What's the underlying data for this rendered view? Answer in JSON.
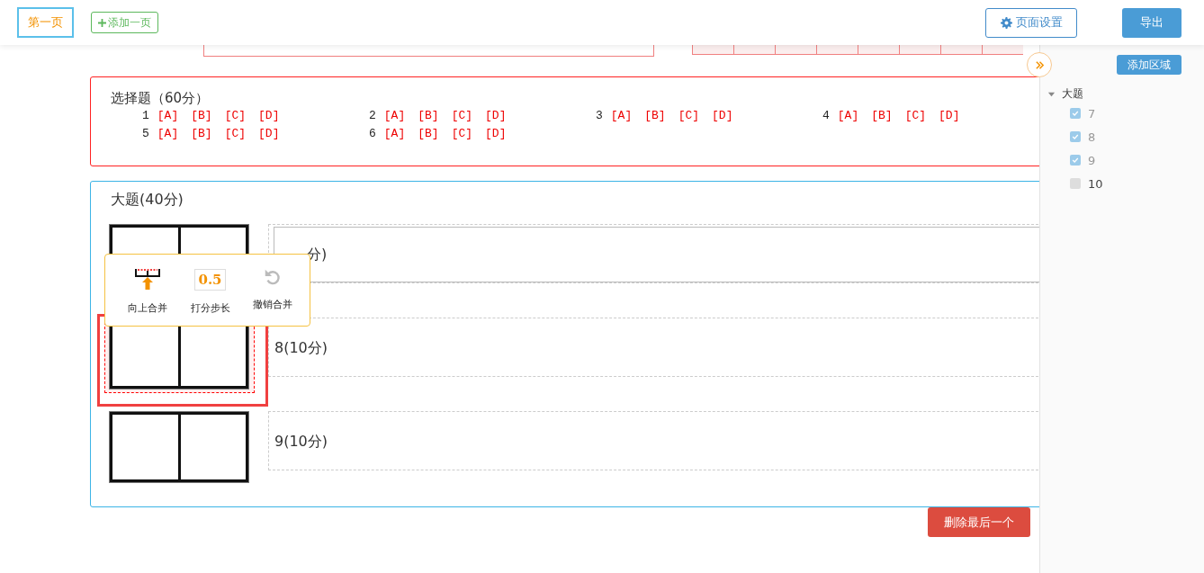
{
  "header": {
    "pages": [
      {
        "label": "第一页",
        "selected": true
      }
    ],
    "add_page": "添加一页",
    "page_settings": "页面设置",
    "export": "导出"
  },
  "choice": {
    "title": "选择题（60分）",
    "questions": [
      {
        "number": "1",
        "options": [
          "[A]",
          "[B]",
          "[C]",
          "[D]"
        ]
      },
      {
        "number": "2",
        "options": [
          "[A]",
          "[B]",
          "[C]",
          "[D]"
        ]
      },
      {
        "number": "3",
        "options": [
          "[A]",
          "[B]",
          "[C]",
          "[D]"
        ]
      },
      {
        "number": "4",
        "options": [
          "[A]",
          "[B]",
          "[C]",
          "[D]"
        ]
      },
      {
        "number": "5",
        "options": [
          "[A]",
          "[B]",
          "[C]",
          "[D]"
        ]
      },
      {
        "number": "6",
        "options": [
          "[A]",
          "[B]",
          "[C]",
          "[D]"
        ]
      }
    ]
  },
  "big_question": {
    "title": "大题(40分)",
    "rows": [
      {
        "label": "分)",
        "selected": false,
        "focused": true
      },
      {
        "label": "8(10分)",
        "selected": true,
        "focused": false
      },
      {
        "label": "9(10分)",
        "selected": false,
        "focused": false
      }
    ]
  },
  "popup": {
    "tools": [
      {
        "kind": "merge-up",
        "label": "向上合并",
        "disabled": false
      },
      {
        "kind": "step",
        "icon_text": "0.5",
        "label": "打分步长",
        "disabled": false
      },
      {
        "kind": "undo",
        "label": "撤销合并",
        "disabled": true
      }
    ]
  },
  "delete_last": "删除最后一个",
  "sidebar": {
    "add_area": "添加区域",
    "tree": [
      {
        "label": "大题",
        "expanded": true,
        "children": [
          {
            "label": "7",
            "checked": true
          },
          {
            "label": "8",
            "checked": true
          },
          {
            "label": "9",
            "checked": true
          },
          {
            "label": "10",
            "checked": false
          }
        ]
      }
    ]
  }
}
